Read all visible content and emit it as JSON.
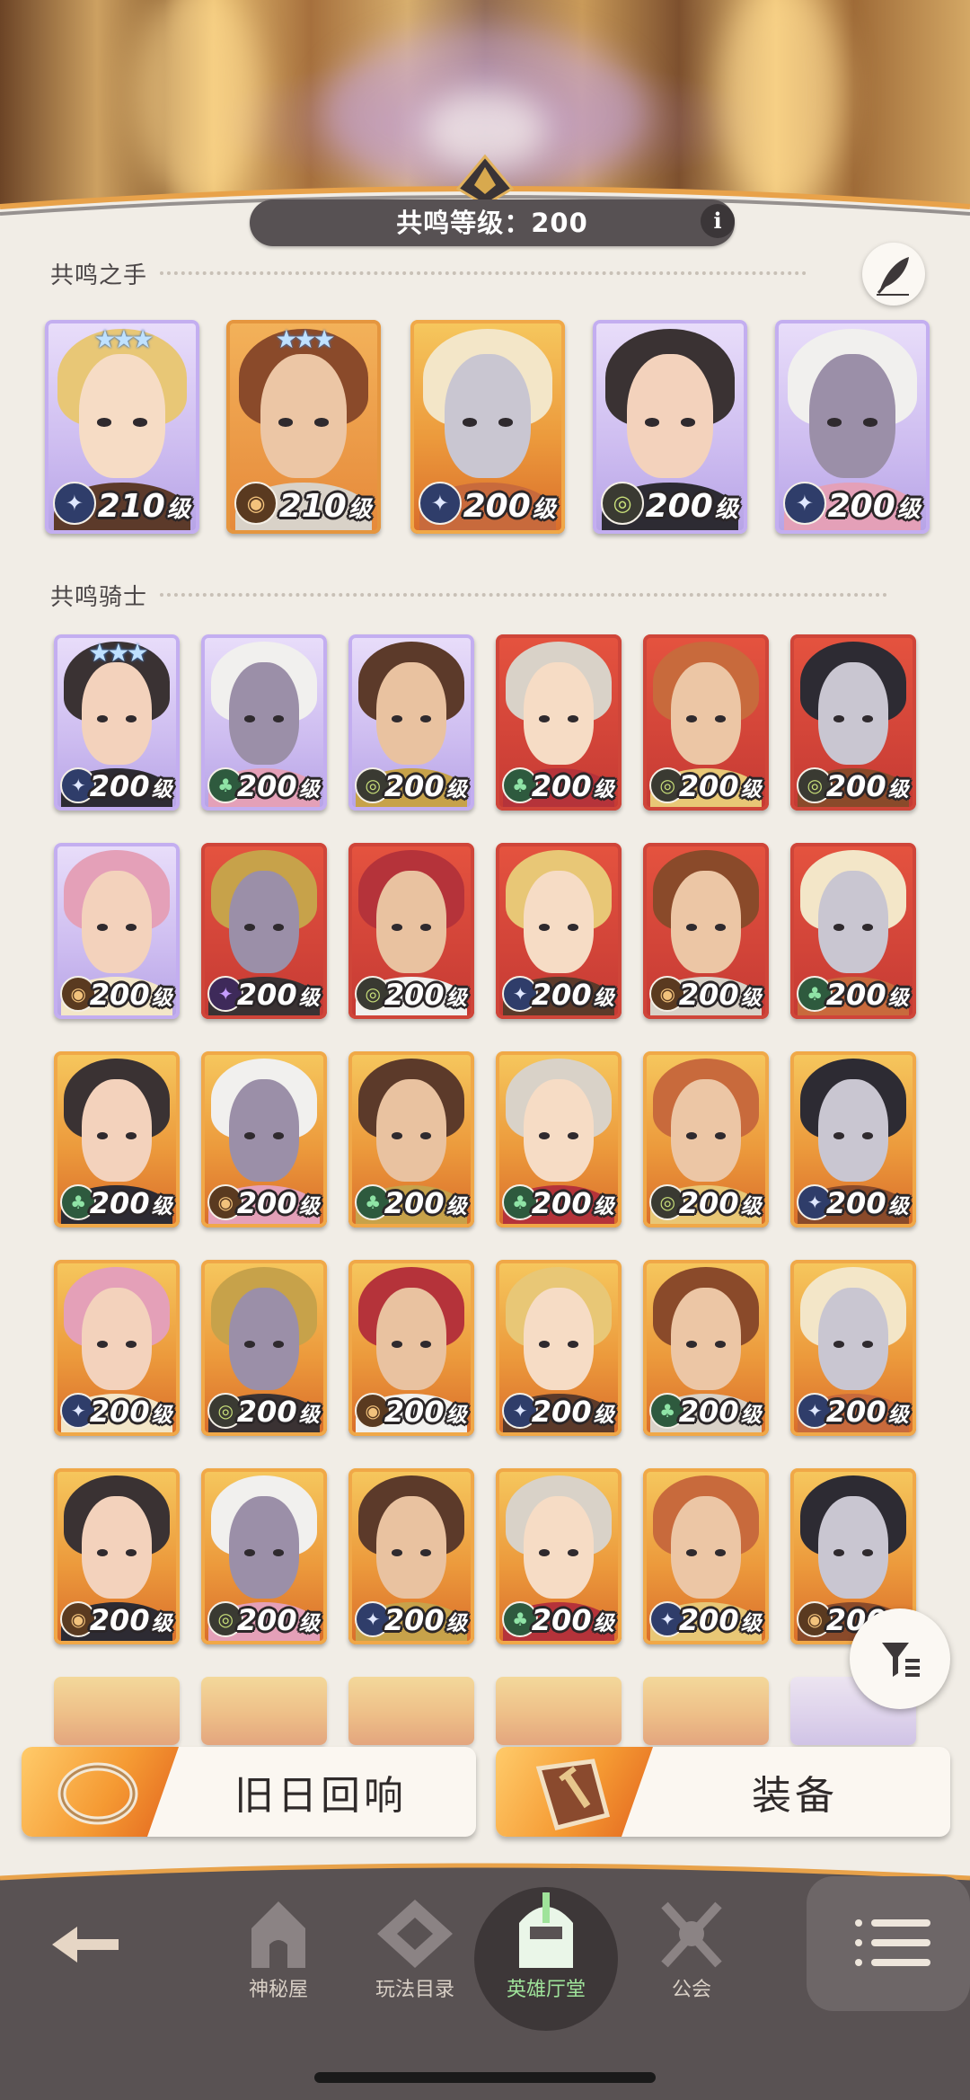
{
  "header": {
    "resonance_level_text": "共鸣等级：200",
    "info_glyph": "i"
  },
  "sections": {
    "hand": {
      "title": "共鸣之手",
      "edit_icon": "quill-icon"
    },
    "knights": {
      "title": "共鸣骑士"
    }
  },
  "level_unit": "级",
  "hand_heroes": [
    {
      "level": "210",
      "faction": "lightbearer",
      "stars": 3,
      "palette": "lavender"
    },
    {
      "level": "210",
      "faction": "mauler",
      "stars": 3,
      "palette": "amber"
    },
    {
      "level": "200",
      "faction": "lightbearer",
      "stars": 0,
      "palette": "orange"
    },
    {
      "level": "200",
      "faction": "graveborn",
      "stars": 0,
      "palette": "lavender"
    },
    {
      "level": "200",
      "faction": "lightbearer",
      "stars": 0,
      "palette": "lavender"
    }
  ],
  "knights": [
    {
      "level": "200",
      "faction": "lightbearer",
      "stars": 3,
      "palette": "lavender"
    },
    {
      "level": "200",
      "faction": "wilder",
      "stars": 0,
      "palette": "lavender"
    },
    {
      "level": "200",
      "faction": "graveborn",
      "stars": 0,
      "palette": "lavender"
    },
    {
      "level": "200",
      "faction": "wilder",
      "stars": 0,
      "palette": "red"
    },
    {
      "level": "200",
      "faction": "graveborn",
      "stars": 0,
      "palette": "red"
    },
    {
      "level": "200",
      "faction": "graveborn",
      "stars": 0,
      "palette": "red"
    },
    {
      "level": "200",
      "faction": "mauler",
      "stars": 0,
      "palette": "lavender"
    },
    {
      "level": "200",
      "faction": "hypogean",
      "stars": 0,
      "palette": "red"
    },
    {
      "level": "200",
      "faction": "graveborn",
      "stars": 0,
      "palette": "red"
    },
    {
      "level": "200",
      "faction": "lightbearer",
      "stars": 0,
      "palette": "red"
    },
    {
      "level": "200",
      "faction": "mauler",
      "stars": 0,
      "palette": "red"
    },
    {
      "level": "200",
      "faction": "wilder",
      "stars": 0,
      "palette": "red"
    },
    {
      "level": "200",
      "faction": "wilder",
      "stars": 0,
      "palette": "orange"
    },
    {
      "level": "200",
      "faction": "mauler",
      "stars": 0,
      "palette": "orange"
    },
    {
      "level": "200",
      "faction": "wilder",
      "stars": 0,
      "palette": "orange"
    },
    {
      "level": "200",
      "faction": "wilder",
      "stars": 0,
      "palette": "orange"
    },
    {
      "level": "200",
      "faction": "graveborn",
      "stars": 0,
      "palette": "orange"
    },
    {
      "level": "200",
      "faction": "lightbearer",
      "stars": 0,
      "palette": "orange"
    },
    {
      "level": "200",
      "faction": "lightbearer",
      "stars": 0,
      "palette": "orange"
    },
    {
      "level": "200",
      "faction": "graveborn",
      "stars": 0,
      "palette": "orange"
    },
    {
      "level": "200",
      "faction": "mauler",
      "stars": 0,
      "palette": "orange"
    },
    {
      "level": "200",
      "faction": "lightbearer",
      "stars": 0,
      "palette": "orange"
    },
    {
      "level": "200",
      "faction": "wilder",
      "stars": 0,
      "palette": "orange"
    },
    {
      "level": "200",
      "faction": "lightbearer",
      "stars": 0,
      "palette": "orange"
    },
    {
      "level": "200",
      "faction": "mauler",
      "stars": 0,
      "palette": "orange"
    },
    {
      "level": "200",
      "faction": "graveborn",
      "stars": 0,
      "palette": "orange"
    },
    {
      "level": "200",
      "faction": "lightbearer",
      "stars": 0,
      "palette": "orange"
    },
    {
      "level": "200",
      "faction": "wilder",
      "stars": 0,
      "palette": "orange"
    },
    {
      "level": "200",
      "faction": "lightbearer",
      "stars": 0,
      "palette": "orange"
    },
    {
      "level": "200",
      "faction": "mauler",
      "stars": 0,
      "palette": "orange"
    }
  ],
  "partial_row_palettes": [
    "orange",
    "orange",
    "orange",
    "orange",
    "orange",
    "lavender"
  ],
  "buttons": {
    "echoes": "旧日回响",
    "equipment": "装备"
  },
  "nav": {
    "back_icon": "back-arrow-icon",
    "items": [
      {
        "label": "神秘屋",
        "icon": "mystery-house-icon",
        "active": false
      },
      {
        "label": "玩法目录",
        "icon": "game-catalog-icon",
        "active": false
      },
      {
        "label": "英雄厅堂",
        "icon": "hero-hall-icon",
        "active": true
      },
      {
        "label": "公会",
        "icon": "guild-icon",
        "active": false
      }
    ],
    "menu_icon": "menu-icon"
  },
  "filter_icon": "filter-icon",
  "colors": {
    "accent_orange": "#f59a33",
    "nav_active": "#9fe39a",
    "bar_dark": "#575153",
    "page_bg": "#f1ede6"
  }
}
